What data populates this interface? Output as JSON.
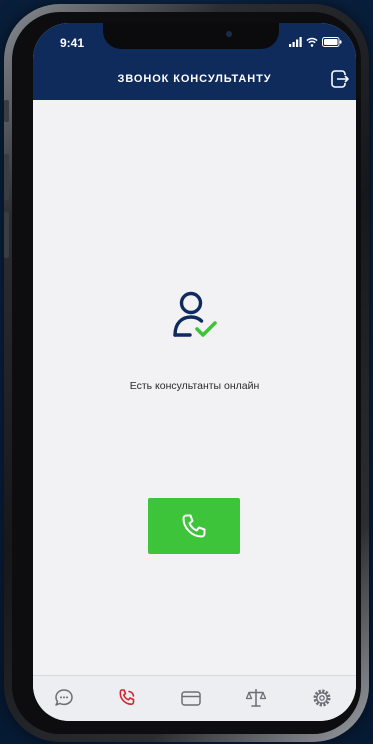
{
  "status_bar": {
    "time": "9:41",
    "icons": [
      "signal-icon",
      "wifi-icon",
      "battery-icon"
    ]
  },
  "header": {
    "title": "ЗВОНОК КОНСУЛЬТАНТУ",
    "exit_icon": "exit-icon",
    "background": "#0e2b5c"
  },
  "main": {
    "status_icon": "consultant-online-icon",
    "status_text": "Есть консультанты онлайн",
    "call_button": {
      "icon": "phone-icon",
      "color": "#3ec43a"
    }
  },
  "tabbar": {
    "active_color": "#d0282d",
    "items": [
      {
        "icon": "chat-icon",
        "active": false
      },
      {
        "icon": "phone-call-icon",
        "active": true
      },
      {
        "icon": "card-icon",
        "active": false
      },
      {
        "icon": "scales-icon",
        "active": false
      },
      {
        "icon": "settings-icon",
        "active": false
      }
    ]
  }
}
